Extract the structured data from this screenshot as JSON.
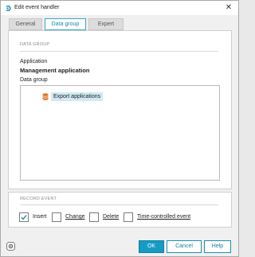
{
  "window": {
    "title": "Edit event handler",
    "close_glyph": "✕"
  },
  "tabs": [
    {
      "label": "General",
      "active": false
    },
    {
      "label": "Data group",
      "active": true
    },
    {
      "label": "Expert",
      "active": false
    }
  ],
  "data_group_section": {
    "heading": "DATA GROUP",
    "application_label": "Application",
    "application_value": "Management application",
    "data_group_label": "Data group",
    "tree_items": [
      {
        "label": "Export applications",
        "icon": "database-icon"
      }
    ]
  },
  "record_event_section": {
    "heading": "RECORD EVENT",
    "checkboxes": [
      {
        "label": "Insert",
        "checked": true
      },
      {
        "label": "Change",
        "checked": false
      },
      {
        "label": "Delete",
        "checked": false
      },
      {
        "label": "Time-controlled event",
        "checked": false
      }
    ]
  },
  "buttons": {
    "ok": "OK",
    "cancel": "Cancel",
    "help": "Help"
  },
  "colors": {
    "accent": "#169bc4",
    "selection": "#cfeaf2",
    "icon_orange": "#e07b2a"
  }
}
